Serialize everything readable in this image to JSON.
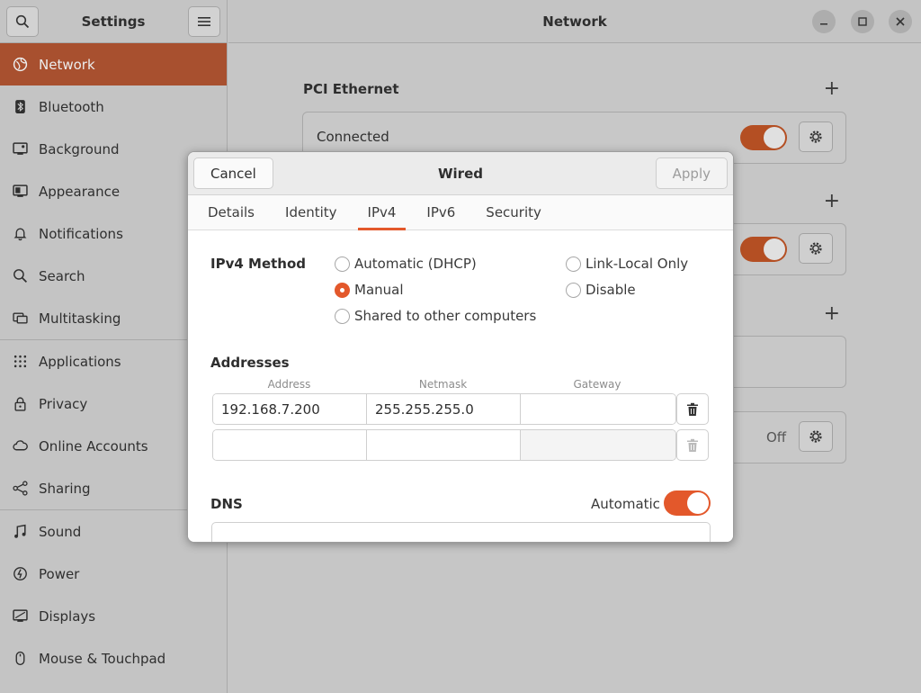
{
  "sidebar": {
    "title": "Settings",
    "items": [
      {
        "label": "Network",
        "icon": "globe-icon"
      },
      {
        "label": "Bluetooth",
        "icon": "bluetooth-icon"
      },
      {
        "label": "Background",
        "icon": "background-icon"
      },
      {
        "label": "Appearance",
        "icon": "appearance-icon"
      },
      {
        "label": "Notifications",
        "icon": "bell-icon"
      },
      {
        "label": "Search",
        "icon": "search-icon"
      },
      {
        "label": "Multitasking",
        "icon": "multitasking-icon"
      },
      {
        "label": "Applications",
        "icon": "apps-grid-icon"
      },
      {
        "label": "Privacy",
        "icon": "lock-icon"
      },
      {
        "label": "Online Accounts",
        "icon": "cloud-icon"
      },
      {
        "label": "Sharing",
        "icon": "share-icon"
      },
      {
        "label": "Sound",
        "icon": "music-note-icon"
      },
      {
        "label": "Power",
        "icon": "power-icon"
      },
      {
        "label": "Displays",
        "icon": "display-icon"
      },
      {
        "label": "Mouse & Touchpad",
        "icon": "mouse-icon"
      }
    ]
  },
  "main": {
    "title": "Network",
    "section_title": "PCI Ethernet",
    "connected_label": "Connected",
    "off_label": "Off"
  },
  "dialog": {
    "title": "Wired",
    "cancel_label": "Cancel",
    "apply_label": "Apply",
    "tabs": [
      "Details",
      "Identity",
      "IPv4",
      "IPv6",
      "Security"
    ],
    "active_tab": "IPv4",
    "method_label": "IPv4 Method",
    "methods": {
      "auto": "Automatic (DHCP)",
      "link_local": "Link-Local Only",
      "manual": "Manual",
      "disable": "Disable",
      "shared": "Shared to other computers"
    },
    "selected_method": "Manual",
    "addresses_label": "Addresses",
    "columns": {
      "address": "Address",
      "netmask": "Netmask",
      "gateway": "Gateway"
    },
    "rows": [
      {
        "address": "192.168.7.200",
        "netmask": "255.255.255.0",
        "gateway": ""
      },
      {
        "address": "",
        "netmask": "",
        "gateway": ""
      }
    ],
    "dns_label": "DNS",
    "dns_auto_label": "Automatic"
  },
  "colors": {
    "accent": "#e3582b",
    "sidebar_active": "#a8502f"
  }
}
